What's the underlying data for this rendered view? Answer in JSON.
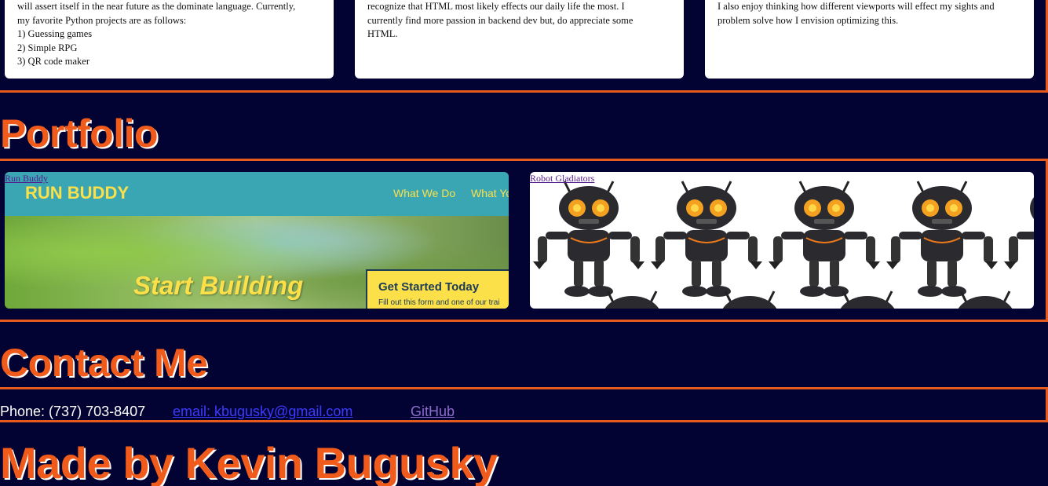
{
  "about": {
    "cards": [
      {
        "lines": "will assert itself in the near future as the dominate language. Currently,\nmy favorite Python projects are as follows:\n1) Guessing games\n2) Simple RPG\n3) QR code maker"
      },
      {
        "lines": "recognize that HTML most likely effects our daily life the most. I\ncurrently find more passion in backend dev but, do appreciate some\nHTML."
      },
      {
        "lines": "I also enjoy thinking how different viewports will effect my sights and\nproblem solve how I envision optimizing this."
      }
    ]
  },
  "portfolio": {
    "heading": "Portfolio",
    "projects": [
      {
        "link": "Run Buddy",
        "preview": {
          "logo": "RUN BUDDY",
          "nav": [
            "What We Do",
            "What Yo"
          ],
          "hero_text": "Start Building",
          "form_title": "Get Started Today",
          "form_sub": "Fill out this form and one of our trai"
        }
      },
      {
        "link": "Robot Gladiators"
      }
    ]
  },
  "contact": {
    "heading": "Contact Me",
    "phone": "Phone: (737) 703-8407",
    "email": "email: kbugusky@gmail.com",
    "github": "GitHub"
  },
  "footer": {
    "heading": "Made by Kevin Bugusky"
  },
  "colors": {
    "background": "#030333",
    "accent": "#f05a1a",
    "border": "#e65a1e"
  }
}
